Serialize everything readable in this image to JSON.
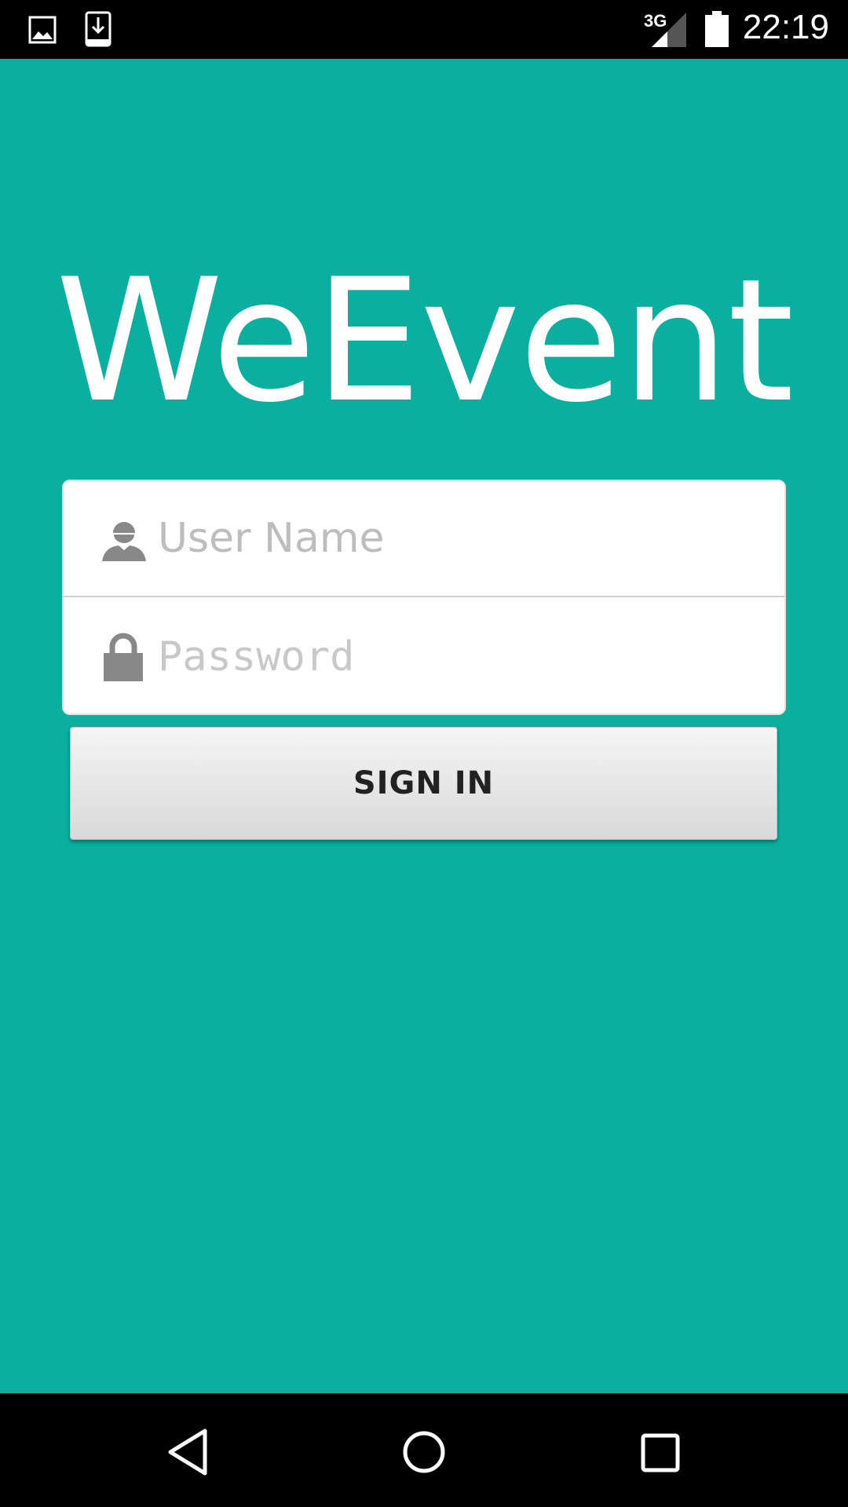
{
  "status_bar": {
    "time": "22:19",
    "network_label": "3G",
    "icons": [
      "image-notification-icon",
      "download-notification-icon",
      "signal-3g-icon",
      "battery-icon"
    ]
  },
  "app": {
    "title": "WeEvent",
    "background_color": "#0aaf9f"
  },
  "login": {
    "username_placeholder": "User Name",
    "password_placeholder": "Password",
    "sign_in_label": "SIGN IN"
  },
  "nav_bar": {
    "buttons": [
      "back-icon",
      "home-icon",
      "recents-icon"
    ]
  }
}
